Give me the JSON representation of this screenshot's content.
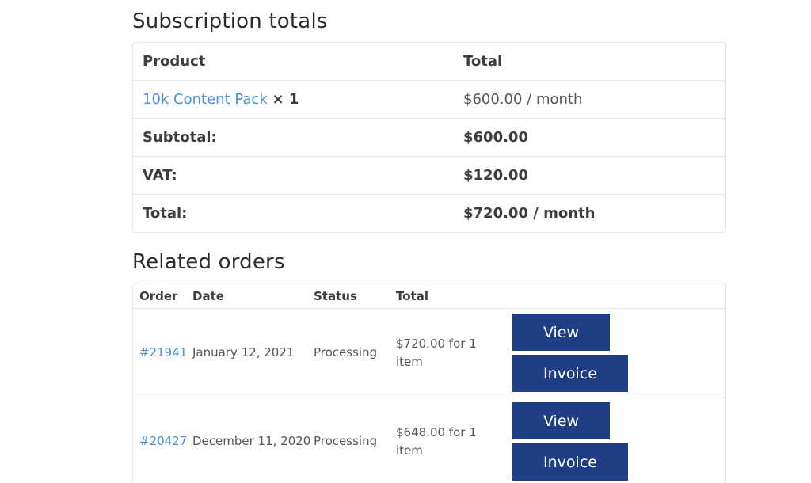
{
  "subscription_totals": {
    "title": "Subscription totals",
    "headers": {
      "product": "Product",
      "total": "Total"
    },
    "line_item": {
      "product_name": "10k Content Pack",
      "quantity": "× 1",
      "total": "$600.00 / month"
    },
    "subtotal": {
      "label": "Subtotal:",
      "value": "$600.00"
    },
    "vat": {
      "label": "VAT:",
      "value": "$120.00"
    },
    "total": {
      "label": "Total:",
      "value": "$720.00 / month"
    }
  },
  "related_orders": {
    "title": "Related orders",
    "headers": {
      "order": "Order",
      "date": "Date",
      "status": "Status",
      "total": "Total"
    },
    "rows": [
      {
        "order": "#21941",
        "date": "January 12, 2021",
        "status": "Processing",
        "total": "$720.00 for 1 item",
        "view_label": "View",
        "invoice_label": "Invoice"
      },
      {
        "order": "#20427",
        "date": "December 11, 2020",
        "status": "Processing",
        "total": "$648.00 for 1 item",
        "view_label": "View",
        "invoice_label": "Invoice"
      }
    ]
  },
  "colors": {
    "link": "#4a90d9",
    "button": "#1e3e85"
  }
}
